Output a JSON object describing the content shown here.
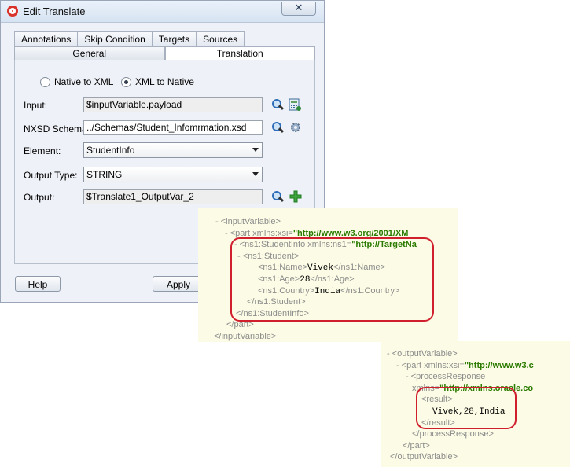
{
  "dialog": {
    "title": "Edit Translate",
    "close_symbol": "✕",
    "tabs_top": [
      "Annotations",
      "Skip Condition",
      "Targets",
      "Sources"
    ],
    "tabs_bottom": [
      "General",
      "Translation"
    ],
    "radio_native_to_xml": "Native to XML",
    "radio_xml_to_native": "XML to Native",
    "labels": {
      "input": "Input:",
      "nxsd_schema": "NXSD Schema:",
      "element": "Element:",
      "output_type": "Output Type:",
      "output": "Output:"
    },
    "values": {
      "input": "$inputVariable.payload",
      "nxsd_schema": "../Schemas/Student_Infomrmation.xsd",
      "element": "StudentInfo",
      "output_type": "STRING",
      "output": "$Translate1_OutputVar_2"
    },
    "buttons": {
      "help": "Help",
      "apply": "Apply"
    }
  },
  "xml_input": {
    "lines": [
      {
        "minus": "-",
        "open": "<inputVariable>"
      },
      {
        "minus": "-",
        "open": "<part",
        "attr": " xmlns:xsi=",
        "val": "\"http://www.w3.org/2001/XM"
      },
      {
        "minus": "-",
        "open": "<ns1:StudentInfo",
        "attr": " xmlns:ns1=",
        "val": "\"http://TargetNa"
      },
      {
        "minus": "-",
        "open": "<ns1:Student>"
      },
      {
        "open": "<ns1:Name>",
        "text": "Vivek",
        "close": "</ns1:Name>"
      },
      {
        "open": "<ns1:Age>",
        "text": "28",
        "close": "</ns1:Age>"
      },
      {
        "open": "<ns1:Country>",
        "text": "India",
        "close": "</ns1:Country>"
      },
      {
        "close": "</ns1:Student>"
      },
      {
        "close": "</ns1:StudentInfo>"
      },
      {
        "close": "</part>"
      },
      {
        "close": "</inputVariable>"
      }
    ]
  },
  "xml_output": {
    "lines": [
      {
        "minus": "-",
        "open": "<outputVariable>"
      },
      {
        "minus": "-",
        "open": "<part",
        "attr": " xmlns:xsi=",
        "val": "\"http://www.w3.c"
      },
      {
        "minus": "-",
        "open": "<processResponse"
      },
      {
        "attr": "xmlns=",
        "val": "\"http://xmlns.oracle.co"
      },
      {
        "open": "<result>"
      },
      {
        "text": "Vivek,28,India"
      },
      {
        "close": "</result>"
      },
      {
        "close": "</processResponse>"
      },
      {
        "close": "</part>"
      },
      {
        "close": "</outputVariable>"
      }
    ]
  },
  "colors": {
    "highlight": "#d0202e",
    "xml_value": "#2a7b00",
    "xml_background": "#fcfbe5"
  }
}
